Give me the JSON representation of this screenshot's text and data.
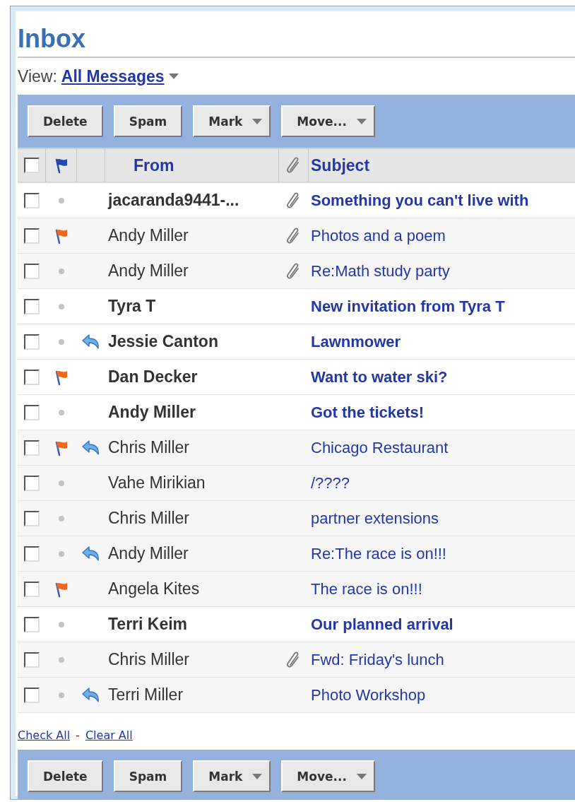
{
  "title": "Inbox",
  "view": {
    "label": "View:",
    "value": "All Messages"
  },
  "toolbar_top": [
    {
      "label": "Delete",
      "kind": "plain"
    },
    {
      "label": "Spam",
      "kind": "plain"
    },
    {
      "label": "Mark",
      "kind": "menu"
    },
    {
      "label": "Move...",
      "kind": "menu"
    }
  ],
  "columns": {
    "checked": false,
    "from": "From",
    "subject": "Subject"
  },
  "rows": [
    {
      "checked": false,
      "unread": true,
      "flagged": false,
      "replied": false,
      "attachment": true,
      "from": "jacaranda9441-...",
      "subject": "Something you can't live with"
    },
    {
      "checked": false,
      "unread": false,
      "flagged": true,
      "replied": false,
      "attachment": true,
      "from": "Andy Miller",
      "subject": "Photos and a poem"
    },
    {
      "checked": false,
      "unread": false,
      "flagged": false,
      "replied": false,
      "attachment": true,
      "from": "Andy Miller",
      "subject": "Re:Math study party"
    },
    {
      "checked": false,
      "unread": true,
      "flagged": false,
      "replied": false,
      "attachment": false,
      "from": "Tyra T",
      "subject": "New invitation from Tyra T"
    },
    {
      "checked": false,
      "unread": true,
      "flagged": false,
      "replied": true,
      "attachment": false,
      "from": "Jessie Canton",
      "subject": "Lawnmower"
    },
    {
      "checked": false,
      "unread": true,
      "flagged": true,
      "replied": false,
      "attachment": false,
      "from": "Dan Decker",
      "subject": "Want to water ski?"
    },
    {
      "checked": false,
      "unread": true,
      "flagged": false,
      "replied": false,
      "attachment": false,
      "from": "Andy Miller",
      "subject": "Got the tickets!"
    },
    {
      "checked": false,
      "unread": false,
      "flagged": true,
      "replied": true,
      "attachment": false,
      "from": "Chris Miller",
      "subject": "Chicago Restaurant"
    },
    {
      "checked": false,
      "unread": false,
      "flagged": false,
      "replied": false,
      "attachment": false,
      "from": "Vahe Mirikian",
      "subject": "/????"
    },
    {
      "checked": false,
      "unread": false,
      "flagged": false,
      "replied": false,
      "attachment": false,
      "from": "Chris Miller",
      "subject": "partner extensions"
    },
    {
      "checked": false,
      "unread": false,
      "flagged": false,
      "replied": true,
      "attachment": false,
      "from": "Andy Miller",
      "subject": "Re:The race is on!!!"
    },
    {
      "checked": false,
      "unread": false,
      "flagged": true,
      "replied": false,
      "attachment": false,
      "from": "Angela Kites",
      "subject": "The race is on!!!"
    },
    {
      "checked": false,
      "unread": true,
      "flagged": false,
      "replied": false,
      "attachment": false,
      "from": "Terri Keim",
      "subject": "Our planned arrival"
    },
    {
      "checked": false,
      "unread": false,
      "flagged": false,
      "replied": false,
      "attachment": true,
      "from": "Chris Miller",
      "subject": "Fwd: Friday's lunch"
    },
    {
      "checked": false,
      "unread": false,
      "flagged": false,
      "replied": true,
      "attachment": false,
      "from": "Terri Miller",
      "subject": "Photo Workshop"
    }
  ],
  "footer": {
    "check_all": "Check All",
    "separator": "-",
    "clear_all": "Clear All"
  },
  "toolbar_bottom": [
    {
      "label": "Delete",
      "kind": "plain"
    },
    {
      "label": "Spam",
      "kind": "plain"
    },
    {
      "label": "Mark",
      "kind": "menu"
    },
    {
      "label": "Move...",
      "kind": "menu"
    }
  ]
}
